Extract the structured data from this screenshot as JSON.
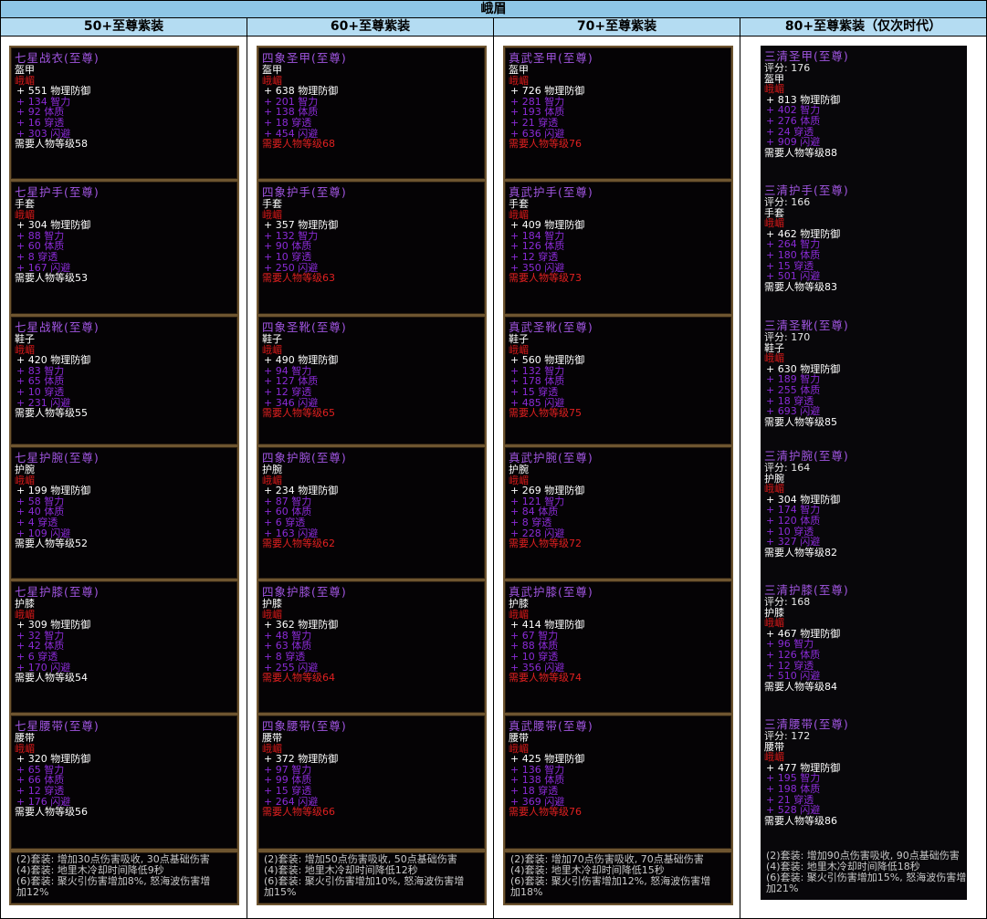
{
  "title": "峨眉",
  "columns": [
    {
      "header": "50+至尊紫装",
      "framed": true,
      "items": [
        {
          "name": "七星战衣(至尊)",
          "type": "盔甲",
          "cls": "峨嵋",
          "def": "+ 551  物理防御",
          "stats": [
            "+ 134  智力",
            "+ 92   体质",
            "+ 16   穿透",
            "+ 303  闪避"
          ],
          "req": "需要人物等级58",
          "req_red": false
        },
        {
          "name": "七星护手(至尊)",
          "type": "手套",
          "cls": "峨嵋",
          "def": "+ 304  物理防御",
          "stats": [
            "+ 88   智力",
            "+ 60   体质",
            "+ 8    穿透",
            "+ 167  闪避"
          ],
          "req": "需要人物等级53",
          "req_red": false
        },
        {
          "name": "七星战靴(至尊)",
          "type": "鞋子",
          "cls": "峨嵋",
          "def": "+ 420  物理防御",
          "stats": [
            "+ 83   智力",
            "+ 65   体质",
            "+ 10   穿透",
            "+ 231  闪避"
          ],
          "req": "需要人物等级55",
          "req_red": false
        },
        {
          "name": "七星护腕(至尊)",
          "type": "护腕",
          "cls": "峨嵋",
          "def": "+ 199  物理防御",
          "stats": [
            "+ 58   智力",
            "+ 40   体质",
            "+ 4    穿透",
            "+ 109  闪避"
          ],
          "req": "需要人物等级52",
          "req_red": false
        },
        {
          "name": "七星护膝(至尊)",
          "type": "护膝",
          "cls": "峨嵋",
          "def": "+ 309  物理防御",
          "stats": [
            "+ 32   智力",
            "+ 42   体质",
            "+ 6    穿透",
            "+ 170  闪避"
          ],
          "req": "需要人物等级54",
          "req_red": false
        },
        {
          "name": "七星腰带(至尊)",
          "type": "腰带",
          "cls": "峨嵋",
          "def": "+ 320  物理防御",
          "stats": [
            "+ 65   智力",
            "+ 66   体质",
            "+ 12   穿透",
            "+ 176  闪避"
          ],
          "req": "需要人物等级56",
          "req_red": false
        }
      ],
      "set": [
        "(2)套装: 增加30点伤害吸收, 30点基础伤害",
        "(4)套装: 地里木冷却时间降低9秒",
        "(6)套装: 聚火引伤害增加8%, 怒海波伤害增",
        "加12%"
      ]
    },
    {
      "header": "60+至尊紫装",
      "framed": true,
      "items": [
        {
          "name": "四象圣甲(至尊)",
          "type": "盔甲",
          "cls": "峨嵋",
          "def": "+ 638  物理防御",
          "stats": [
            "+ 201  智力",
            "+ 138  体质",
            "+ 18   穿透",
            "+ 454  闪避"
          ],
          "req": "需要人物等级68",
          "req_red": true
        },
        {
          "name": "四象护手(至尊)",
          "type": "手套",
          "cls": "峨嵋",
          "def": "+ 357  物理防御",
          "stats": [
            "+ 132  智力",
            "+ 90   体质",
            "+ 10   穿透",
            "+ 250  闪避"
          ],
          "req": "需要人物等级63",
          "req_red": true
        },
        {
          "name": "四象圣靴(至尊)",
          "type": "鞋子",
          "cls": "峨嵋",
          "def": "+ 490  物理防御",
          "stats": [
            "+ 94   智力",
            "+ 127  体质",
            "+ 12   穿透",
            "+ 346  闪避"
          ],
          "req": "需要人物等级65",
          "req_red": true
        },
        {
          "name": "四象护腕(至尊)",
          "type": "护腕",
          "cls": "峨嵋",
          "def": "+ 234  物理防御",
          "stats": [
            "+ 87   智力",
            "+ 60   体质",
            "+ 6    穿透",
            "+ 163  闪避"
          ],
          "req": "需要人物等级62",
          "req_red": true
        },
        {
          "name": "四象护膝(至尊)",
          "type": "护膝",
          "cls": "峨嵋",
          "def": "+ 362  物理防御",
          "stats": [
            "+ 48   智力",
            "+ 63   体质",
            "+ 8    穿透",
            "+ 255  闪避"
          ],
          "req": "需要人物等级64",
          "req_red": true
        },
        {
          "name": "四象腰带(至尊)",
          "type": "腰带",
          "cls": "峨嵋",
          "def": "+ 372  物理防御",
          "stats": [
            "+ 97   智力",
            "+ 99   体质",
            "+ 15   穿透",
            "+ 264  闪避"
          ],
          "req": "需要人物等级66",
          "req_red": true
        }
      ],
      "set": [
        "(2)套装: 增加50点伤害吸收, 50点基础伤害",
        "(4)套装: 地里木冷却时间降低12秒",
        "(6)套装: 聚火引伤害增加10%, 怒海波伤害增",
        "加15%"
      ]
    },
    {
      "header": "70+至尊紫装",
      "framed": true,
      "items": [
        {
          "name": "真武圣甲(至尊)",
          "type": "盔甲",
          "cls": "峨嵋",
          "def": "+ 726  物理防御",
          "stats": [
            "+ 281  智力",
            "+ 193  体质",
            "+ 21   穿透",
            "+ 636  闪避"
          ],
          "req": "需要人物等级76",
          "req_red": true
        },
        {
          "name": "真武护手(至尊)",
          "type": "手套",
          "cls": "峨嵋",
          "def": "+ 409  物理防御",
          "stats": [
            "+ 184  智力",
            "+ 126  体质",
            "+ 12   穿透",
            "+ 350  闪避"
          ],
          "req": "需要人物等级73",
          "req_red": true
        },
        {
          "name": "真武圣靴(至尊)",
          "type": "鞋子",
          "cls": "峨嵋",
          "def": "+ 560  物理防御",
          "stats": [
            "+ 132  智力",
            "+ 178  体质",
            "+ 15   穿透",
            "+ 485  闪避"
          ],
          "req": "需要人物等级75",
          "req_red": true
        },
        {
          "name": "真武护腕(至尊)",
          "type": "护腕",
          "cls": "峨嵋",
          "def": "+ 269  物理防御",
          "stats": [
            "+ 121  智力",
            "+ 84   体质",
            "+ 8    穿透",
            "+ 228  闪避"
          ],
          "req": "需要人物等级72",
          "req_red": true
        },
        {
          "name": "真武护膝(至尊)",
          "type": "护膝",
          "cls": "峨嵋",
          "def": "+ 414  物理防御",
          "stats": [
            "+ 67   智力",
            "+ 88   体质",
            "+ 10   穿透",
            "+ 356  闪避"
          ],
          "req": "需要人物等级74",
          "req_red": true
        },
        {
          "name": "真武腰带(至尊)",
          "type": "腰带",
          "cls": "峨嵋",
          "def": "+ 425  物理防御",
          "stats": [
            "+ 136  智力",
            "+ 138  体质",
            "+ 18   穿透",
            "+ 369  闪避"
          ],
          "req": "需要人物等级76",
          "req_red": true
        }
      ],
      "set": [
        "(2)套装: 增加70点伤害吸收, 70点基础伤害",
        "(4)套装: 地里木冷却时间降低15秒",
        "(6)套装: 聚火引伤害增加12%, 怒海波伤害增",
        "加18%"
      ]
    },
    {
      "header": "80+至尊紫装（仅次时代）",
      "framed": false,
      "items": [
        {
          "name": "三清圣甲(至尊)",
          "score": "评分: 176",
          "type": "盔甲",
          "cls": "峨嵋",
          "def": "+ 813  物理防御",
          "stats": [
            "+ 402  智力",
            "+ 276  体质",
            "+ 24   穿透",
            "+ 909  闪避"
          ],
          "req": "需要人物等级88",
          "req_red": false
        },
        {
          "name": "三清护手(至尊)",
          "score": "评分: 166",
          "type": "手套",
          "cls": "峨嵋",
          "def": "+ 462  物理防御",
          "stats": [
            "+ 264  智力",
            "+ 180  体质",
            "+ 15   穿透",
            "+ 501  闪避"
          ],
          "req": "需要人物等级83",
          "req_red": false
        },
        {
          "name": "三清圣靴(至尊)",
          "score": "评分: 170",
          "type": "鞋子",
          "cls": "峨嵋",
          "def": "+ 630  物理防御",
          "stats": [
            "+ 189  智力",
            "+ 255  体质",
            "+ 18   穿透",
            "+ 693  闪避"
          ],
          "req": "需要人物等级85",
          "req_red": false
        },
        {
          "name": "三清护腕(至尊)",
          "score": "评分: 164",
          "type": "护腕",
          "cls": "峨嵋",
          "def": "+ 304  物理防御",
          "stats": [
            "+ 174  智力",
            "+ 120  体质",
            "+ 10   穿透",
            "+ 327  闪避"
          ],
          "req": "需要人物等级82",
          "req_red": false
        },
        {
          "name": "三清护膝(至尊)",
          "score": "评分: 168",
          "type": "护膝",
          "cls": "峨嵋",
          "def": "+ 467  物理防御",
          "stats": [
            "+ 96   智力",
            "+ 126  体质",
            "+ 12   穿透",
            "+ 510  闪避"
          ],
          "req": "需要人物等级84",
          "req_red": false
        },
        {
          "name": "三清腰带(至尊)",
          "score": "评分: 172",
          "type": "腰带",
          "cls": "峨嵋",
          "def": "+ 477  物理防御",
          "stats": [
            "+ 195  智力",
            "+ 198  体质",
            "+ 21   穿透",
            "+ 528  闪避"
          ],
          "req": "需要人物等级86",
          "req_red": false
        }
      ],
      "set": [
        "(2)套装: 增加90点伤害吸收, 90点基础伤害",
        "(4)套装: 地里木冷却时间降低18秒",
        "(6)套装: 聚火引伤害增加15%, 怒海波伤害增",
        "加21%"
      ]
    }
  ]
}
